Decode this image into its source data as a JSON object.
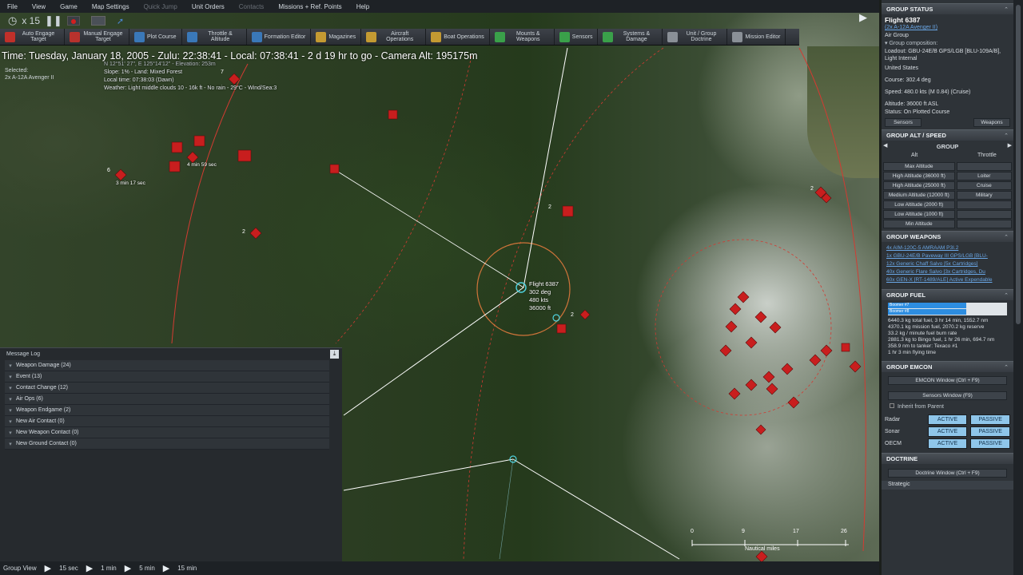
{
  "menu": {
    "items": [
      "File",
      "View",
      "Game",
      "Map Settings",
      "Quick Jump",
      "Unit Orders",
      "Contacts",
      "Missions + Ref. Points",
      "Help"
    ]
  },
  "controls": {
    "speed": "x 15"
  },
  "toolbar": {
    "buttons": [
      {
        "label": "Auto Engage Target",
        "icon": "target-icon",
        "color": "#c0302a"
      },
      {
        "label": "Manual Engage Target",
        "icon": "crosshair-icon",
        "color": "#b8322d"
      },
      {
        "label": "Plot Course",
        "icon": "course-icon",
        "color": "#3a78b8"
      },
      {
        "label": "Throttle & Altitude",
        "icon": "throttle-icon",
        "color": "#3a78b8"
      },
      {
        "label": "Formation Editor",
        "icon": "formation-icon",
        "color": "#3a78b8"
      },
      {
        "label": "Magazines",
        "icon": "magazine-icon",
        "color": "#c49a32"
      },
      {
        "label": "Aircraft Operations",
        "icon": "aircraft-icon",
        "color": "#c49a32"
      },
      {
        "label": "Boat Operations",
        "icon": "boat-icon",
        "color": "#c49a32"
      },
      {
        "label": "Mounts & Weapons",
        "icon": "weapons-icon",
        "color": "#3aa04a"
      },
      {
        "label": "Sensors",
        "icon": "sensor-icon",
        "color": "#3aa04a"
      },
      {
        "label": "Systems & Damage",
        "icon": "gear-icon",
        "color": "#3aa04a"
      },
      {
        "label": "Unit / Group Doctrine",
        "icon": "doctrine-icon",
        "color": "#8a9097"
      },
      {
        "label": "Mission Editor",
        "icon": "mission-icon",
        "color": "#8a9097"
      }
    ]
  },
  "time": "Time: Tuesday, January 18, 2005 - Zulu: 22:38:41 - Local: 07:38:41 - 2 d 19 hr to go - Camera Alt: 195175m",
  "selection": {
    "label": "Selected:",
    "unit": "2x A-12A Avenger II"
  },
  "terrain": {
    "coords": "N 12°51' 27\", E 125°14'12\" - Elevation: 253m",
    "slope": "Slope: 1% - Land: Mixed Forest",
    "local": "Local time: 07:38:03 (Dawn)",
    "weather": "Weather: Light middle clouds 10 - 16k ft - No rain - 29°C - Wind/Sea:3"
  },
  "map": {
    "flight": {
      "name": "Flight 6387",
      "heading": "302 deg",
      "speed": "480 kts",
      "alt": "36000 ft"
    },
    "labels": [
      {
        "t": "4 min 59 sec"
      },
      {
        "t": "3 min 17 sec"
      },
      {
        "t": "6"
      },
      {
        "t": "2"
      },
      {
        "t": "7"
      },
      {
        "t": "2"
      },
      {
        "t": "2"
      },
      {
        "t": "2"
      }
    ],
    "scale": {
      "ticks": [
        "0",
        "9",
        "17",
        "26"
      ],
      "label": "Nautical miles"
    }
  },
  "messagelog": {
    "title": "Message Log",
    "rows": [
      {
        "label": "Weapon Damage (24)"
      },
      {
        "label": "Event (13)"
      },
      {
        "label": "Contact Change (12)"
      },
      {
        "label": "Air Ops (6)"
      },
      {
        "label": "Weapon Endgame (2)"
      },
      {
        "label": "New Air Contact (0)"
      },
      {
        "label": "New Weapon Contact (0)"
      },
      {
        "label": "New Ground Contact (0)"
      }
    ]
  },
  "bottom": {
    "group_view": "Group View",
    "steps": [
      "15 sec",
      "1 min",
      "5 min",
      "15 min"
    ]
  },
  "panel": {
    "status_title": "GROUP STATUS",
    "name": "Flight 6387",
    "type_link": "(2x A-12A Avenger II)",
    "type": "Air Group",
    "composition": "Group composition:",
    "loadout": "Loadout: GBU-24E/B GPS/LGB [BLU-109A/B], Light Internal",
    "country": "United States",
    "course": "Course: 302.4 deg",
    "speed": "Speed: 480.0 kts (M 0.84) (Cruise)",
    "altitude": "Altitude: 36000 ft ASL",
    "status": "Status: On Plotted Course",
    "sensors_btn": "Sensors",
    "weapons_btn": "Weapons",
    "alt_title": "GROUP ALT / SPEED",
    "group": "GROUP",
    "alt_col": "Alt",
    "thr_col": "Throttle",
    "alt_rows": [
      [
        "Max Altitude",
        ""
      ],
      [
        "High Altitude (36000 ft)",
        "Loiter"
      ],
      [
        "High Altitude (25000 ft)",
        "Cruise"
      ],
      [
        "Medium Altitude (12000 ft)",
        "Military"
      ],
      [
        "Low Altitude (2000 ft)",
        ""
      ],
      [
        "Low Altitude (1000 ft)",
        ""
      ],
      [
        "Min Altitude",
        ""
      ]
    ],
    "weap_title": "GROUP WEAPONS",
    "weapons": [
      "4x AIM-120C-5 AMRAAM P3I.2",
      "1x GBU-24E/B Paveway III GPS/LGB [BLU-",
      "12x Generic Chaff Salvo [5x Cartridges]",
      "40x Generic Flare Salvo [3x Cartridges, Du",
      "60x GEN-X [RT-1489/ALE] Active Expendable"
    ],
    "fuel_title": "GROUP FUEL",
    "fuel_bars": [
      {
        "label": "Boomer #7",
        "frac": 0.66
      },
      {
        "label": "Boomer #8",
        "frac": 0.66
      }
    ],
    "fuel_lines": [
      "6440.3 kg total fuel, 3 hr 14 min, 1552.7 nm",
      "4370.1 kg mission fuel, 2070.2 kg reserve",
      "33.2 kg / minute fuel burn rate",
      "2881.3 kg to Bingo fuel, 1 hr 26 min, 694.7 nm",
      "358.9 nm to tanker: Texaco #1",
      "1 hr 3 min flying time"
    ],
    "emcon_title": "GROUP EMCON",
    "emcon_btn": "EMCON Window (Ctrl + F9)",
    "sensors_win": "Sensors Window (F9)",
    "inherit": "Inherit from Parent",
    "emcon_rows": [
      {
        "name": "Radar",
        "a": "ACTIVE",
        "p": "PASSIVE",
        "active": false
      },
      {
        "name": "Sonar",
        "a": "ACTIVE",
        "p": "PASSIVE",
        "active": false
      },
      {
        "name": "OECM",
        "a": "ACTIVE",
        "p": "PASSIVE",
        "active": false
      }
    ],
    "doc_title": "DOCTRINE",
    "doc_btn": "Doctrine Window (Ctrl + F9)",
    "strategic": "Strategic"
  }
}
